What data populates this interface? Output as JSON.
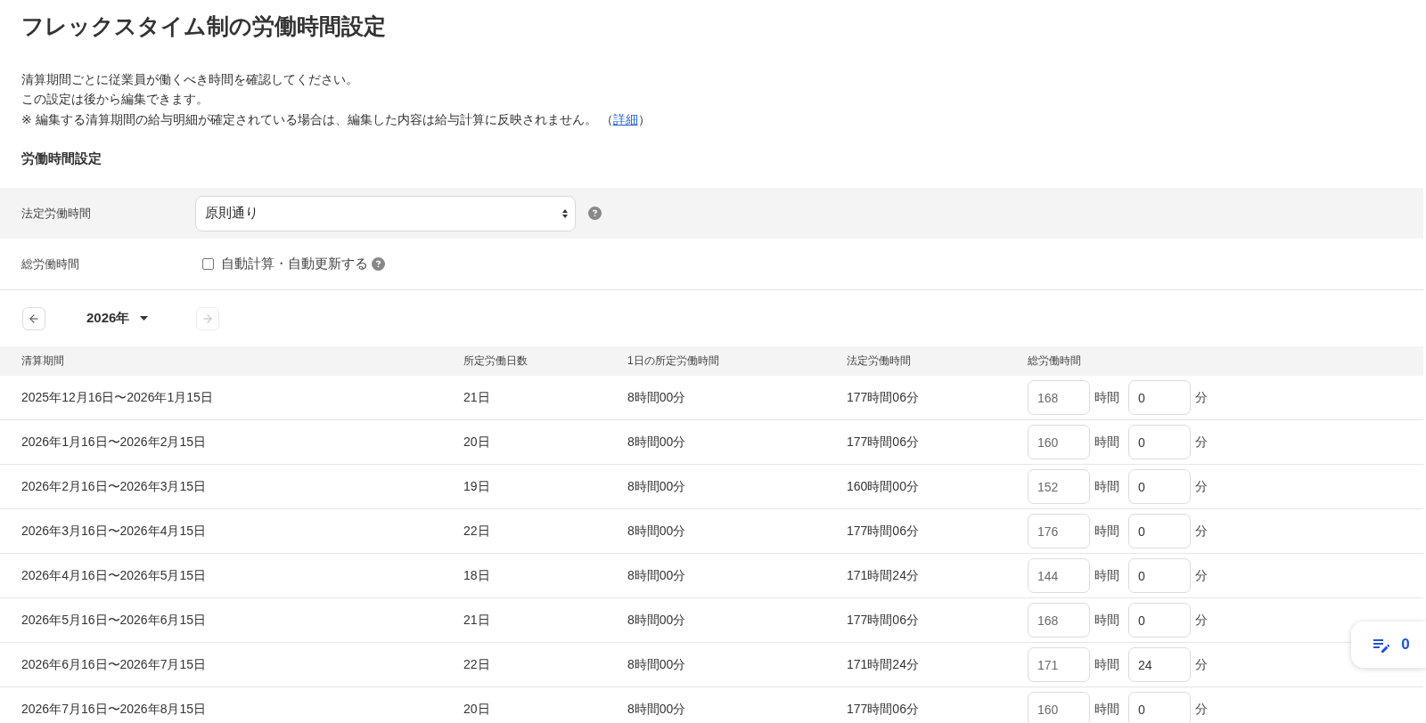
{
  "title": "フレックスタイム制の労働時間設定",
  "intro": {
    "lines": [
      "清算期間ごとに従業員が働くべき時間を確認してください。",
      "この設定は後から編集できます。"
    ],
    "note": {
      "text": "※ 編集する清算期間の給与明細が確定されている場合は、編集した内容は給与計算に反映されません。",
      "link_before": "（",
      "link": "詳細",
      "link_after": "）"
    }
  },
  "section": {
    "heading": "労働時間設定",
    "rows": [
      {
        "kind": "select",
        "label": "法定労働時間",
        "value": "原則通り"
      },
      {
        "kind": "checkbox",
        "label": "総労働時間",
        "option": "自動計算・自動更新する",
        "checked": false
      }
    ]
  },
  "year_nav": {
    "year": "2026年",
    "prev": {
      "disabled": false
    },
    "next": {
      "disabled": true
    }
  },
  "table": {
    "columns": [
      "清算期間",
      "所定労働日数",
      "1日の所定労働時間",
      "法定労働時間",
      "総労働時間"
    ],
    "rows": [
      {
        "period": "2025年12月16日〜2026年1月15日",
        "days": "21日",
        "daily_hours": "8時間00分",
        "legal_hours": "177時間06分",
        "hours": {
          "placeholder": "168"
        },
        "hours_unit": "時間",
        "minutes": {
          "value": "0"
        },
        "minutes_unit": "分"
      },
      {
        "period": "2026年1月16日〜2026年2月15日",
        "days": "20日",
        "daily_hours": "8時間00分",
        "legal_hours": "177時間06分",
        "hours": {
          "placeholder": "160"
        },
        "hours_unit": "時間",
        "minutes": {
          "value": "0"
        },
        "minutes_unit": "分"
      },
      {
        "period": "2026年2月16日〜2026年3月15日",
        "days": "19日",
        "daily_hours": "8時間00分",
        "legal_hours": "160時間00分",
        "hours": {
          "placeholder": "152"
        },
        "hours_unit": "時間",
        "minutes": {
          "value": "0"
        },
        "minutes_unit": "分"
      },
      {
        "period": "2026年3月16日〜2026年4月15日",
        "days": "22日",
        "daily_hours": "8時間00分",
        "legal_hours": "177時間06分",
        "hours": {
          "placeholder": "176"
        },
        "hours_unit": "時間",
        "minutes": {
          "value": "0"
        },
        "minutes_unit": "分"
      },
      {
        "period": "2026年4月16日〜2026年5月15日",
        "days": "18日",
        "daily_hours": "8時間00分",
        "legal_hours": "171時間24分",
        "hours": {
          "placeholder": "144"
        },
        "hours_unit": "時間",
        "minutes": {
          "value": "0"
        },
        "minutes_unit": "分"
      },
      {
        "period": "2026年5月16日〜2026年6月15日",
        "days": "21日",
        "daily_hours": "8時間00分",
        "legal_hours": "177時間06分",
        "hours": {
          "placeholder": "168"
        },
        "hours_unit": "時間",
        "minutes": {
          "value": "0"
        },
        "minutes_unit": "分"
      },
      {
        "period": "2026年6月16日〜2026年7月15日",
        "days": "22日",
        "daily_hours": "8時間00分",
        "legal_hours": "171時間24分",
        "hours": {
          "placeholder": "171"
        },
        "hours_unit": "時間",
        "minutes": {
          "value": "24"
        },
        "minutes_unit": "分"
      },
      {
        "period": "2026年7月16日〜2026年8月15日",
        "days": "20日",
        "daily_hours": "8時間00分",
        "legal_hours": "177時間06分",
        "hours": {
          "placeholder": "160"
        },
        "hours_unit": "時間",
        "minutes": {
          "value": "0"
        },
        "minutes_unit": "分"
      }
    ]
  },
  "edit_badge": {
    "count": "0"
  }
}
